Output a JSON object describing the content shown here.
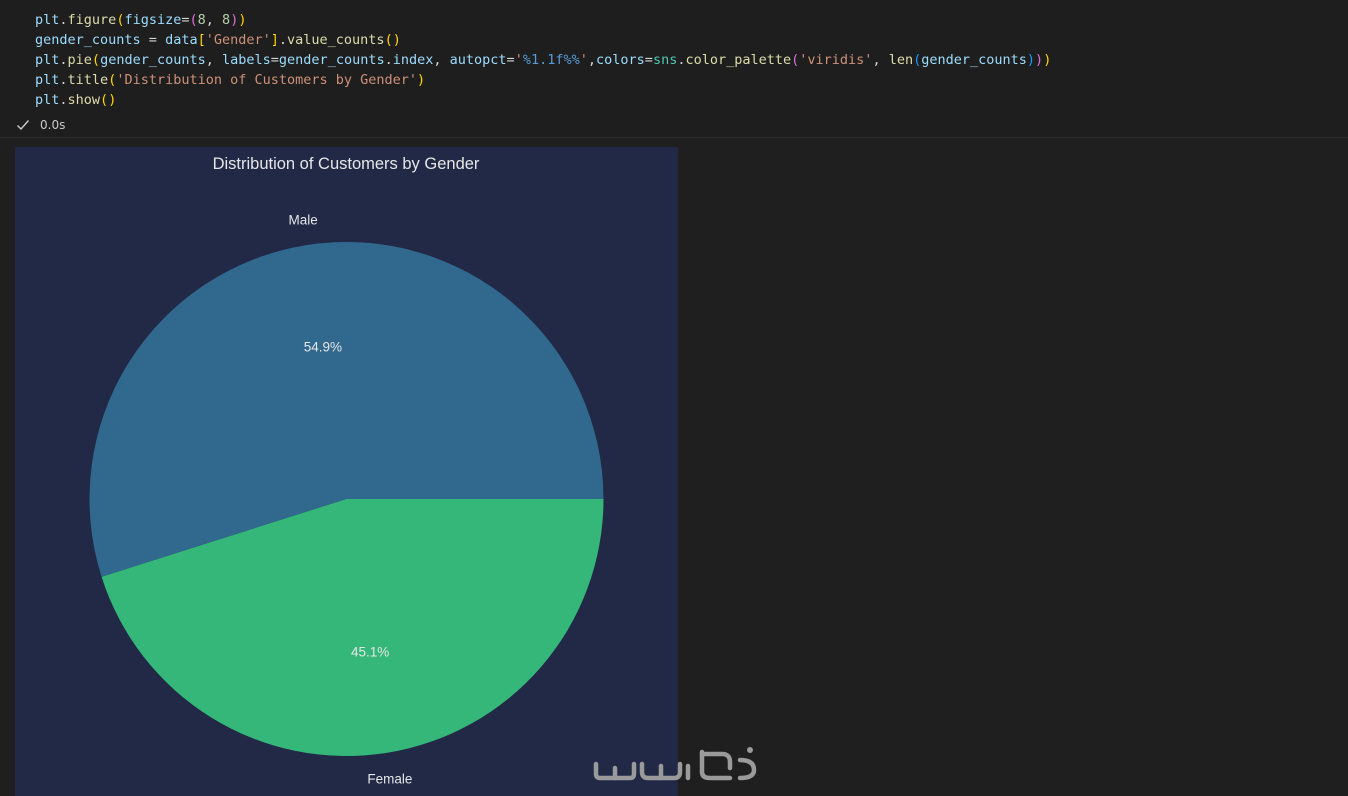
{
  "code": {
    "lines": [
      [
        {
          "t": "plt",
          "c": "tk-var"
        },
        {
          "t": ".",
          "c": "tk-op"
        },
        {
          "t": "figure",
          "c": "tk-fn"
        },
        {
          "t": "(",
          "c": "tk-b1"
        },
        {
          "t": "figsize",
          "c": "tk-var"
        },
        {
          "t": "=",
          "c": "tk-op"
        },
        {
          "t": "(",
          "c": "tk-b2"
        },
        {
          "t": "8",
          "c": "tk-num"
        },
        {
          "t": ", ",
          "c": "tk-op"
        },
        {
          "t": "8",
          "c": "tk-num"
        },
        {
          "t": ")",
          "c": "tk-b2"
        },
        {
          "t": ")",
          "c": "tk-b1"
        }
      ],
      [
        {
          "t": "gender_counts",
          "c": "tk-var"
        },
        {
          "t": " = ",
          "c": "tk-op"
        },
        {
          "t": "data",
          "c": "tk-var"
        },
        {
          "t": "[",
          "c": "tk-b1"
        },
        {
          "t": "'Gender'",
          "c": "tk-str"
        },
        {
          "t": "]",
          "c": "tk-b1"
        },
        {
          "t": ".",
          "c": "tk-op"
        },
        {
          "t": "value_counts",
          "c": "tk-fn"
        },
        {
          "t": "(",
          "c": "tk-b1"
        },
        {
          "t": ")",
          "c": "tk-b1"
        }
      ],
      [
        {
          "t": "plt",
          "c": "tk-var"
        },
        {
          "t": ".",
          "c": "tk-op"
        },
        {
          "t": "pie",
          "c": "tk-fn"
        },
        {
          "t": "(",
          "c": "tk-b1"
        },
        {
          "t": "gender_counts",
          "c": "tk-var"
        },
        {
          "t": ", ",
          "c": "tk-op"
        },
        {
          "t": "labels",
          "c": "tk-var"
        },
        {
          "t": "=",
          "c": "tk-op"
        },
        {
          "t": "gender_counts",
          "c": "tk-var"
        },
        {
          "t": ".",
          "c": "tk-op"
        },
        {
          "t": "index",
          "c": "tk-var"
        },
        {
          "t": ", ",
          "c": "tk-op"
        },
        {
          "t": "autopct",
          "c": "tk-var"
        },
        {
          "t": "=",
          "c": "tk-op"
        },
        {
          "t": "'",
          "c": "tk-str"
        },
        {
          "t": "%1.1f",
          "c": "tk-fmt"
        },
        {
          "t": "%%",
          "c": "tk-fmt"
        },
        {
          "t": "'",
          "c": "tk-str"
        },
        {
          "t": ",",
          "c": "tk-op"
        },
        {
          "t": "colors",
          "c": "tk-var"
        },
        {
          "t": "=",
          "c": "tk-op"
        },
        {
          "t": "sns",
          "c": "tk-ent"
        },
        {
          "t": ".",
          "c": "tk-op"
        },
        {
          "t": "color_palette",
          "c": "tk-fn"
        },
        {
          "t": "(",
          "c": "tk-b2"
        },
        {
          "t": "'viridis'",
          "c": "tk-str"
        },
        {
          "t": ", ",
          "c": "tk-op"
        },
        {
          "t": "len",
          "c": "tk-fn"
        },
        {
          "t": "(",
          "c": "tk-b3"
        },
        {
          "t": "gender_counts",
          "c": "tk-var"
        },
        {
          "t": ")",
          "c": "tk-b3"
        },
        {
          "t": ")",
          "c": "tk-b2"
        },
        {
          "t": ")",
          "c": "tk-b1"
        }
      ],
      [
        {
          "t": "plt",
          "c": "tk-var"
        },
        {
          "t": ".",
          "c": "tk-op"
        },
        {
          "t": "title",
          "c": "tk-fn"
        },
        {
          "t": "(",
          "c": "tk-b1"
        },
        {
          "t": "'Distribution of Customers by Gender'",
          "c": "tk-str"
        },
        {
          "t": ")",
          "c": "tk-b1"
        }
      ],
      [
        {
          "t": "plt",
          "c": "tk-var"
        },
        {
          "t": ".",
          "c": "tk-op"
        },
        {
          "t": "show",
          "c": "tk-fn"
        },
        {
          "t": "(",
          "c": "tk-b1"
        },
        {
          "t": ")",
          "c": "tk-b1"
        }
      ]
    ]
  },
  "status": {
    "icon": "check-icon",
    "duration": "0.0s",
    "color": "#cccccc"
  },
  "chart_data": {
    "type": "pie",
    "title": "Distribution of Customers by Gender",
    "labels": [
      "Male",
      "Female"
    ],
    "values": [
      54.9,
      45.1
    ],
    "pct_labels": [
      "54.9%",
      "45.1%"
    ],
    "colors": [
      "#31688e",
      "#35b779"
    ],
    "start_angle_deg": 0,
    "background": "#212947",
    "text_color": "#e6e6e6"
  },
  "watermark": {
    "text": "خمسات",
    "color": "#9a9a9a"
  }
}
